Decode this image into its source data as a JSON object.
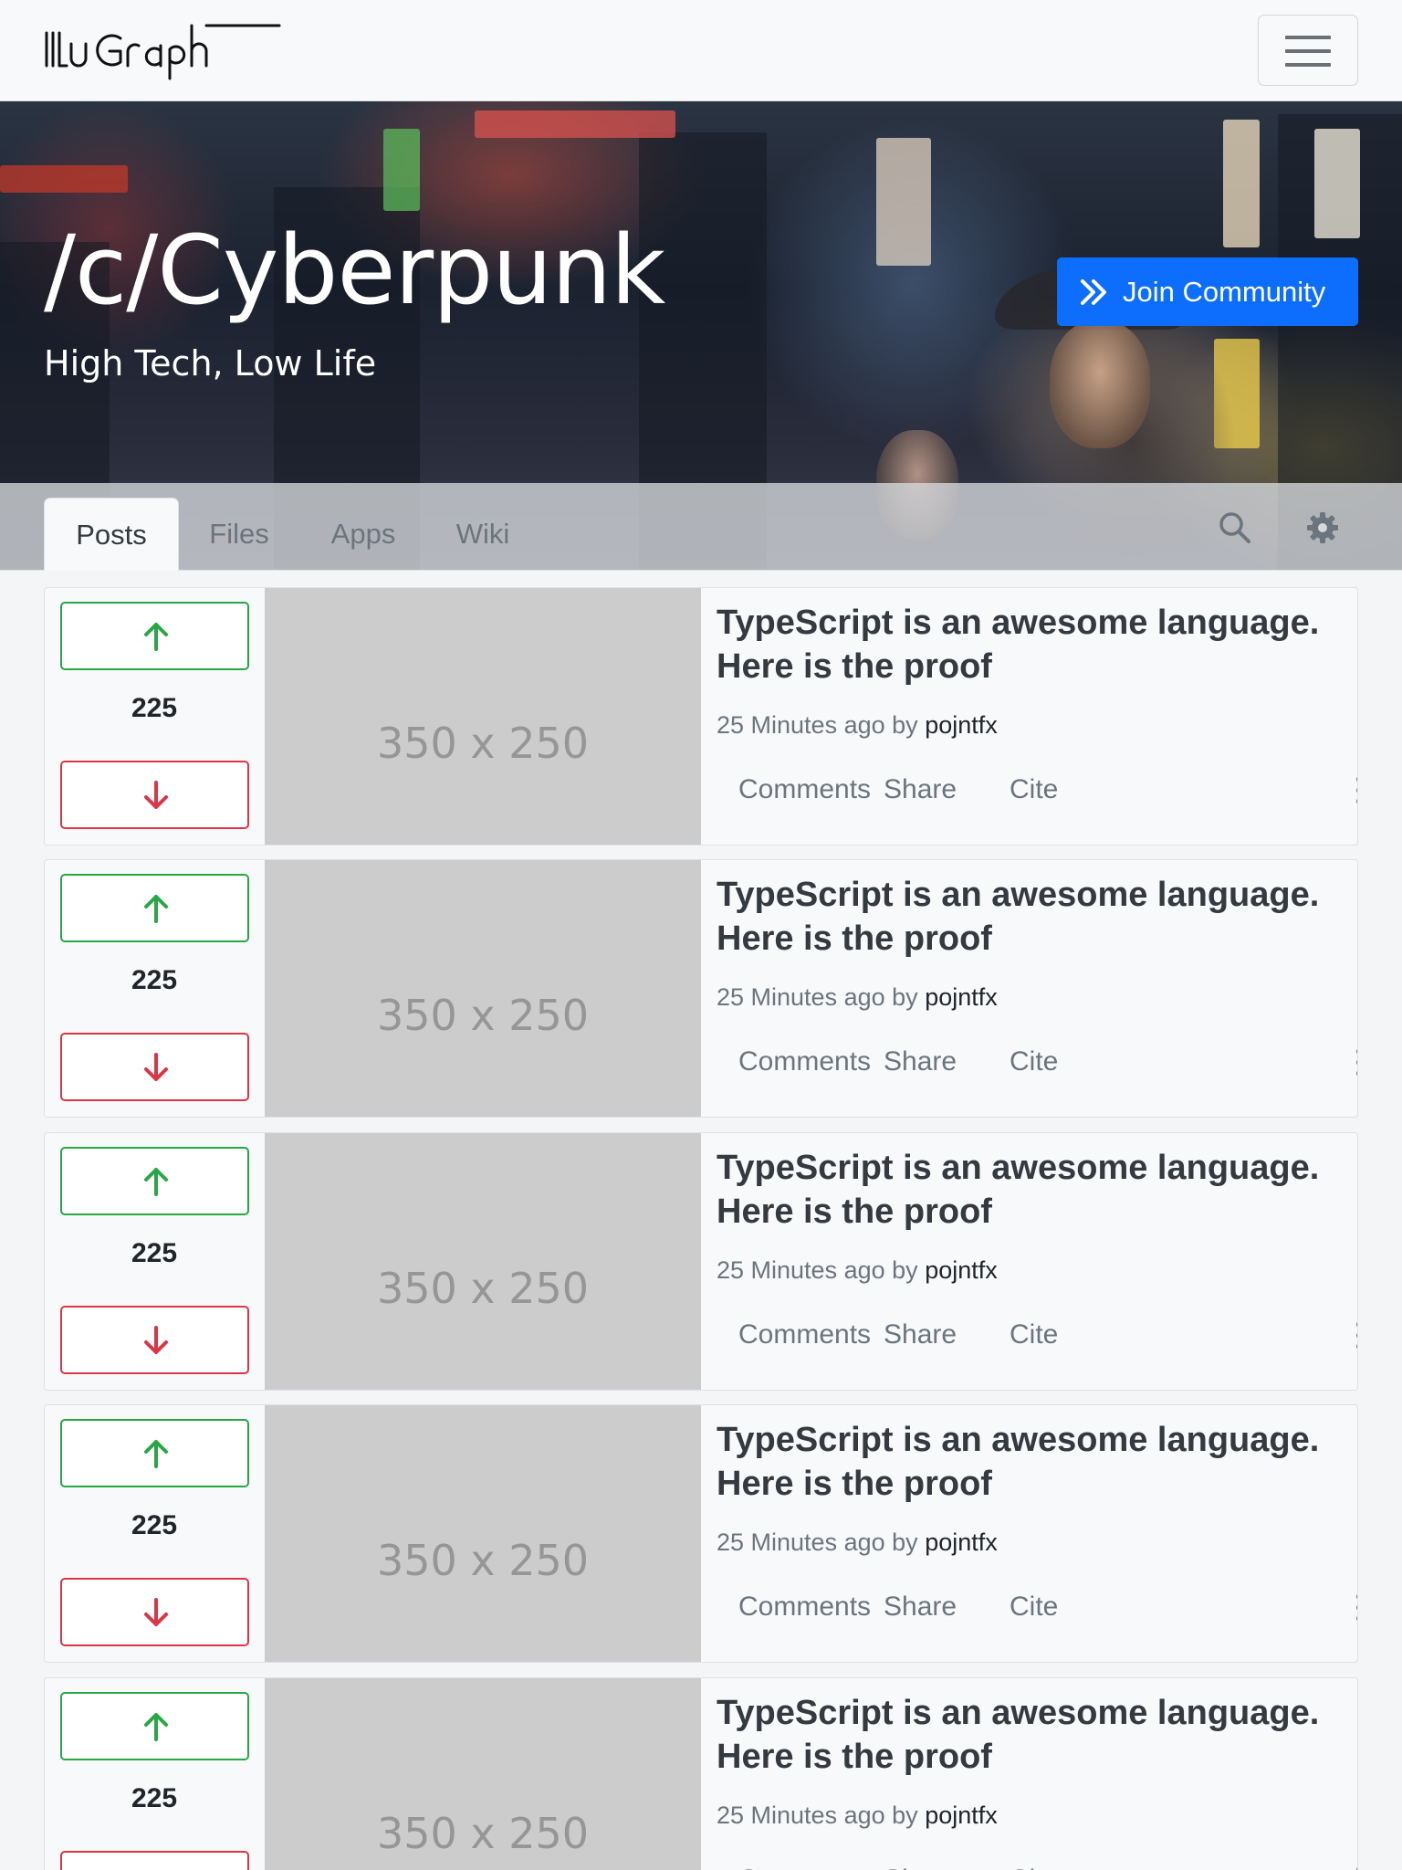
{
  "brand": {
    "logo_text": "IlluGraph",
    "logo_icon": "illugraph-logo"
  },
  "navbar": {
    "menu_icon": "hamburger-menu-icon"
  },
  "hero": {
    "title": "/c/Cyberpunk",
    "subtitle": "High Tech, Low Life",
    "join_label": "Join Community",
    "join_icon": "double-chevron-right-icon"
  },
  "tabs": [
    {
      "label": "Posts",
      "active": true
    },
    {
      "label": "Files",
      "active": false
    },
    {
      "label": "Apps",
      "active": false
    },
    {
      "label": "Wiki",
      "active": false
    }
  ],
  "toolbar_icons": [
    "search-icon",
    "gear-icon"
  ],
  "colors": {
    "primary": "#0d6efd",
    "upvote": "#28a745",
    "downvote": "#dc3545",
    "placeholder_bg": "#cccccc"
  },
  "posts": [
    {
      "votes": "225",
      "thumb": "350 x 250",
      "title": "TypeScript is an awesome language. Here is the proof",
      "time": "25 Minutes ago",
      "by": "by",
      "author": "pojntfx",
      "actions": [
        "Comments",
        "Share",
        "Cite"
      ]
    },
    {
      "votes": "225",
      "thumb": "350 x 250",
      "title": "TypeScript is an awesome language. Here is the proof",
      "time": "25 Minutes ago",
      "by": "by",
      "author": "pojntfx",
      "actions": [
        "Comments",
        "Share",
        "Cite"
      ]
    },
    {
      "votes": "225",
      "thumb": "350 x 250",
      "title": "TypeScript is an awesome language. Here is the proof",
      "time": "25 Minutes ago",
      "by": "by",
      "author": "pojntfx",
      "actions": [
        "Comments",
        "Share",
        "Cite"
      ]
    },
    {
      "votes": "225",
      "thumb": "350 x 250",
      "title": "TypeScript is an awesome language. Here is the proof",
      "time": "25 Minutes ago",
      "by": "by",
      "author": "pojntfx",
      "actions": [
        "Comments",
        "Share",
        "Cite"
      ]
    },
    {
      "votes": "225",
      "thumb": "350 x 250",
      "title": "TypeScript is an awesome language. Here is the proof",
      "time": "25 Minutes ago",
      "by": "by",
      "author": "pojntfx",
      "actions": [
        "Comments",
        "Share",
        "Cite"
      ]
    }
  ]
}
